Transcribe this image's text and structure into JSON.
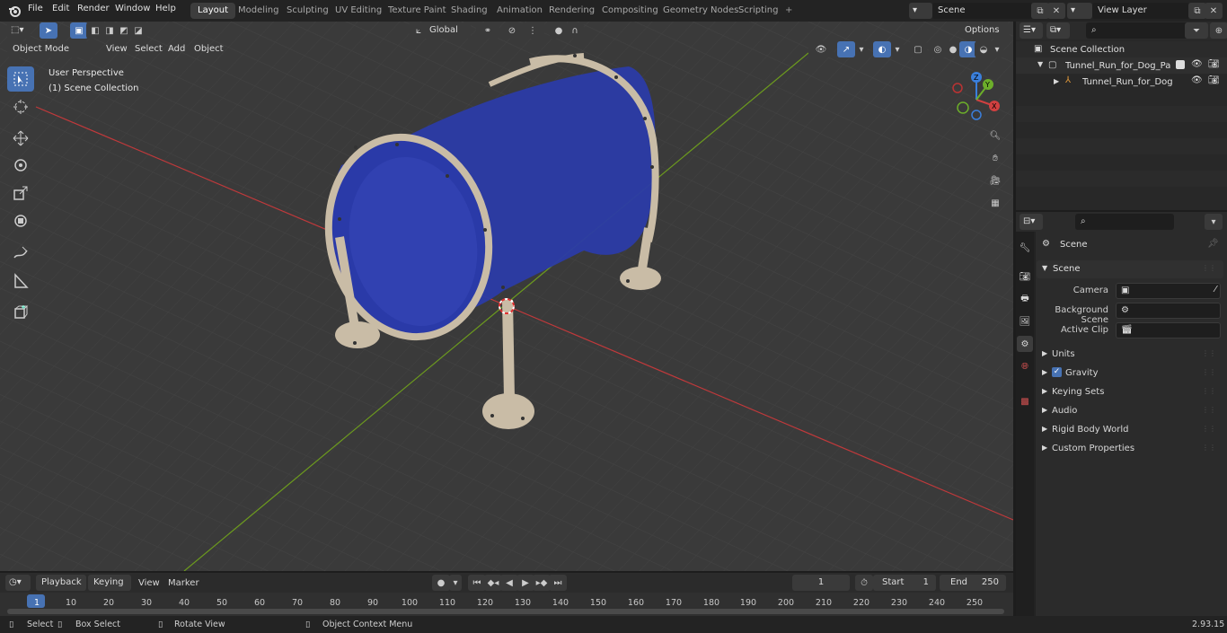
{
  "topbar": {
    "menus": [
      "File",
      "Edit",
      "Render",
      "Window",
      "Help"
    ],
    "workspaces": [
      "Layout",
      "Modeling",
      "Sculpting",
      "UV Editing",
      "Texture Paint",
      "Shading",
      "Animation",
      "Rendering",
      "Compositing",
      "Geometry Nodes",
      "Scripting"
    ],
    "active_workspace": "Layout",
    "add_tab": "+",
    "scene_name": "Scene",
    "view_layer": "View Layer"
  },
  "viewport": {
    "mode": "Object Mode",
    "menus": [
      "View",
      "Select",
      "Add",
      "Object"
    ],
    "orientation": "Global",
    "options_label": "Options",
    "overlay_title": "User Perspective",
    "overlay_subtitle": "(1) Scene Collection",
    "gizmo": {
      "x": "X",
      "y": "Y",
      "z": "Z"
    }
  },
  "outliner": {
    "root": "Scene Collection",
    "items": [
      {
        "label": "Tunnel_Run_for_Dog_Park_Bl"
      },
      {
        "label": "Tunnel_Run_for_Dog_Par"
      }
    ]
  },
  "properties": {
    "context_title": "Scene",
    "panel_title": "Scene",
    "rows": [
      {
        "label": "Camera"
      },
      {
        "label": "Background Scene"
      },
      {
        "label": "Active Clip"
      }
    ],
    "subpanels": [
      "Units",
      "Gravity",
      "Keying Sets",
      "Audio",
      "Rigid Body World",
      "Custom Properties"
    ]
  },
  "timeline": {
    "menus": [
      "Playback",
      "Keying",
      "View",
      "Marker"
    ],
    "current_frame": "1",
    "start_label": "Start",
    "start_value": "1",
    "end_label": "End",
    "end_value": "250",
    "ruler": [
      "1",
      "10",
      "20",
      "30",
      "40",
      "50",
      "60",
      "70",
      "80",
      "90",
      "100",
      "110",
      "120",
      "130",
      "140",
      "150",
      "160",
      "170",
      "180",
      "190",
      "200",
      "210",
      "220",
      "230",
      "240",
      "250"
    ]
  },
  "statusbar": {
    "items": [
      "Select",
      "Box Select",
      "Rotate View",
      "Object Context Menu"
    ],
    "version": "2.93.15"
  },
  "colors": {
    "accent": "#4772b3",
    "tunnel": "#2a3aa8",
    "frame": "#c9bca6",
    "x_axis": "#c0393b",
    "y_axis": "#6c9a1e"
  }
}
